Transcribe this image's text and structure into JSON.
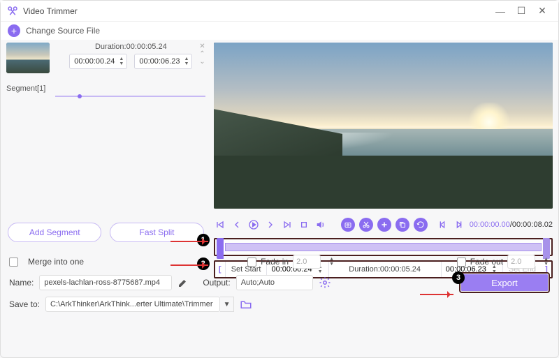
{
  "app": {
    "title": "Video Trimmer"
  },
  "toolbar": {
    "change_source": "Change Source File"
  },
  "segment": {
    "name": "Segment[1]",
    "duration_label": "Duration:00:00:05.24",
    "start_time": "00:00:00.24",
    "end_time": "00:00:06.23"
  },
  "buttons": {
    "add_segment": "Add Segment",
    "fast_split": "Fast Split",
    "export": "Export"
  },
  "playback": {
    "current": "00:00:00.00",
    "total": "00:00:08.02"
  },
  "trim": {
    "set_start": "Set Start",
    "start_time": "00:00:00.24",
    "duration": "Duration:00:00:05.24",
    "end_time": "00:00:06.23",
    "set_end": "Set End"
  },
  "options": {
    "merge": "Merge into one",
    "fade_in": "Fade in",
    "fade_in_val": "2.0",
    "fade_out": "Fade out",
    "fade_out_val": "2.0"
  },
  "output": {
    "name_label": "Name:",
    "name_value": "pexels-lachlan-ross-8775687.mp4",
    "output_label": "Output:",
    "output_value": "Auto;Auto",
    "save_label": "Save to:",
    "save_path": "C:\\ArkThinker\\ArkThink...erter Ultimate\\Trimmer"
  },
  "callouts": {
    "c1": "1",
    "c2": "2",
    "c3": "3"
  }
}
